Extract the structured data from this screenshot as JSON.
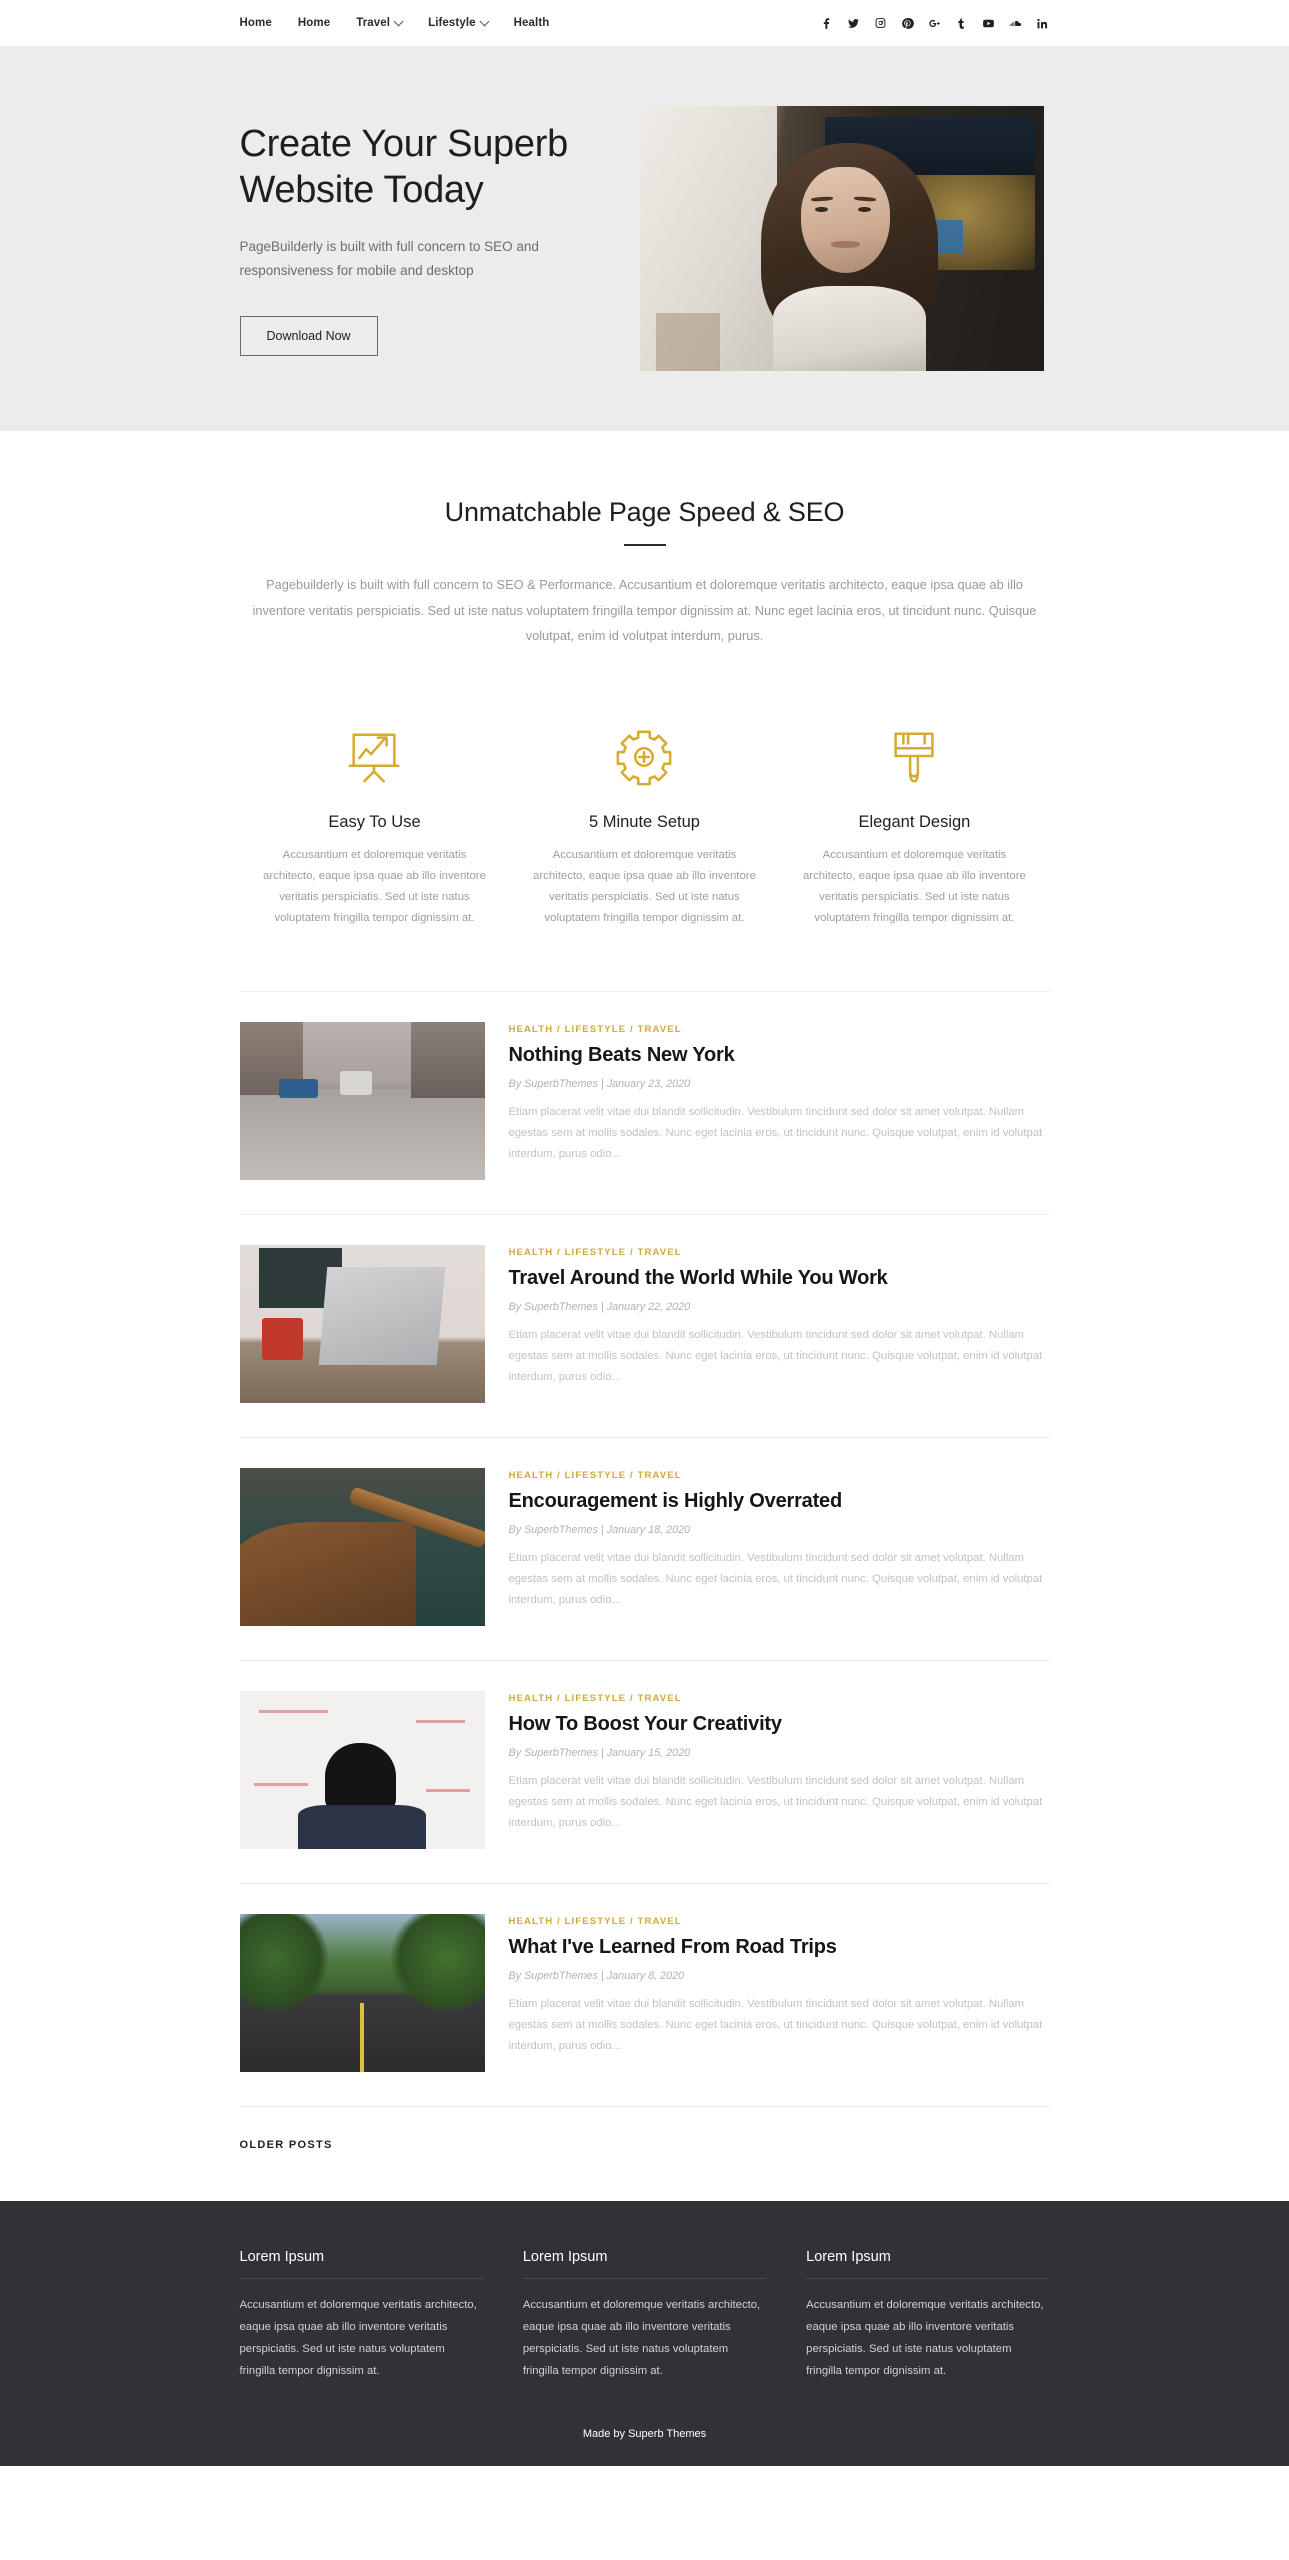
{
  "nav": {
    "items": [
      {
        "label": "Home",
        "has_dropdown": false
      },
      {
        "label": "Home",
        "has_dropdown": false
      },
      {
        "label": "Travel",
        "has_dropdown": true
      },
      {
        "label": "Lifestyle",
        "has_dropdown": true
      },
      {
        "label": "Health",
        "has_dropdown": false
      }
    ],
    "social": [
      {
        "name": "facebook-icon"
      },
      {
        "name": "twitter-icon"
      },
      {
        "name": "instagram-icon"
      },
      {
        "name": "pinterest-icon"
      },
      {
        "name": "google-plus-icon"
      },
      {
        "name": "tumblr-icon"
      },
      {
        "name": "youtube-icon"
      },
      {
        "name": "soundcloud-icon"
      },
      {
        "name": "linkedin-icon"
      }
    ]
  },
  "hero": {
    "title": "Create Your Superb Website Today",
    "subtitle": "PageBuilderly is built with full concern to SEO and responsiveness for mobile and desktop",
    "button": "Download Now",
    "image_alt": "portrait-photo-woman"
  },
  "speed_section": {
    "title": "Unmatchable Page Speed & SEO",
    "description": "Pagebuilderly is built with full concern to SEO & Performance. Accusantium et doloremque veritatis architecto, eaque ipsa quae ab illo inventore veritatis perspiciatis. Sed ut iste natus voluptatem fringilla tempor dignissim at. Nunc eget lacinia eros, ut tincidunt nunc. Quisque volutpat, enim id volutpat interdum, purus."
  },
  "features": [
    {
      "icon": "presentation-chart-icon",
      "title": "Easy To Use",
      "text": "Accusantium et doloremque veritatis architecto, eaque ipsa quae ab illo inventore veritatis perspiciatis. Sed ut iste natus voluptatem fringilla tempor dignissim at."
    },
    {
      "icon": "gear-plus-icon",
      "title": "5 Minute Setup",
      "text": "Accusantium et doloremque veritatis architecto, eaque ipsa quae ab illo inventore veritatis perspiciatis. Sed ut iste natus voluptatem fringilla tempor dignissim at."
    },
    {
      "icon": "paint-brush-icon",
      "title": "Elegant Design",
      "text": "Accusantium et doloremque veritatis architecto, eaque ipsa quae ab illo inventore veritatis perspiciatis. Sed ut iste natus voluptatem fringilla tempor dignissim at."
    }
  ],
  "posts": [
    {
      "categories": "HEALTH / LIFESTYLE / TRAVEL",
      "title": "Nothing Beats New York",
      "meta": "By SuperbThemes | January 23, 2020",
      "excerpt": "Etiam placerat velit vitae dui blandit sollicitudin. Vestibulum tincidunt sed dolor sit amet volutpat. Nullam egestas sem at mollis sodales. Nunc eget lacinia eros, ut tincidunt nunc. Quisque volutpat, enim id volutpat interdum, purus odio...",
      "thumb": "city-street-photo"
    },
    {
      "categories": "HEALTH / LIFESTYLE / TRAVEL",
      "title": "Travel Around the World While You Work",
      "meta": "By SuperbThemes | January 22, 2020",
      "excerpt": "Etiam placerat velit vitae dui blandit sollicitudin. Vestibulum tincidunt sed dolor sit amet volutpat. Nullam egestas sem at mollis sodales. Nunc eget lacinia eros, ut tincidunt nunc. Quisque volutpat, enim id volutpat interdum, purus odio...",
      "thumb": "laptop-desk-photo"
    },
    {
      "categories": "HEALTH / LIFESTYLE / TRAVEL",
      "title": "Encouragement is Highly Overrated",
      "meta": "By SuperbThemes | January 18, 2020",
      "excerpt": "Etiam placerat velit vitae dui blandit sollicitudin. Vestibulum tincidunt sed dolor sit amet volutpat. Nullam egestas sem at mollis sodales. Nunc eget lacinia eros, ut tincidunt nunc. Quisque volutpat, enim id volutpat interdum, purus odio...",
      "thumb": "wooden-boat-lake-photo"
    },
    {
      "categories": "HEALTH / LIFESTYLE / TRAVEL",
      "title": "How To Boost Your Creativity",
      "meta": "By SuperbThemes | January 15, 2020",
      "excerpt": "Etiam placerat velit vitae dui blandit sollicitudin. Vestibulum tincidunt sed dolor sit amet volutpat. Nullam egestas sem at mollis sodales. Nunc eget lacinia eros, ut tincidunt nunc. Quisque volutpat, enim id volutpat interdum, purus odio...",
      "thumb": "man-whiteboard-photo"
    },
    {
      "categories": "HEALTH / LIFESTYLE / TRAVEL",
      "title": "What I've Learned From Road Trips",
      "meta": "By SuperbThemes | January 8, 2020",
      "excerpt": "Etiam placerat velit vitae dui blandit sollicitudin. Vestibulum tincidunt sed dolor sit amet volutpat. Nullam egestas sem at mollis sodales. Nunc eget lacinia eros, ut tincidunt nunc. Quisque volutpat, enim id volutpat interdum, purus odio...",
      "thumb": "tree-lined-road-photo"
    }
  ],
  "pagination": {
    "older_posts": "OLDER POSTS"
  },
  "footer": {
    "widgets": [
      {
        "title": "Lorem Ipsum",
        "text": "Accusantium et doloremque veritatis architecto, eaque ipsa quae ab illo inventore veritatis perspiciatis. Sed ut iste natus voluptatem fringilla tempor dignissim at."
      },
      {
        "title": "Lorem Ipsum",
        "text": "Accusantium et doloremque veritatis architecto, eaque ipsa quae ab illo inventore veritatis perspiciatis. Sed ut iste natus voluptatem fringilla tempor dignissim at."
      },
      {
        "title": "Lorem Ipsum",
        "text": "Accusantium et doloremque veritatis architecto, eaque ipsa quae ab illo inventore veritatis perspiciatis. Sed ut iste natus voluptatem fringilla tempor dignissim at."
      }
    ],
    "credit": "Made by Superb Themes"
  },
  "colors": {
    "accent_gold": "#cfa93c",
    "hero_bg": "#ececec",
    "footer_bg": "#323236",
    "text_dark": "#1f1f1f",
    "text_muted": "#9a9a9a"
  }
}
